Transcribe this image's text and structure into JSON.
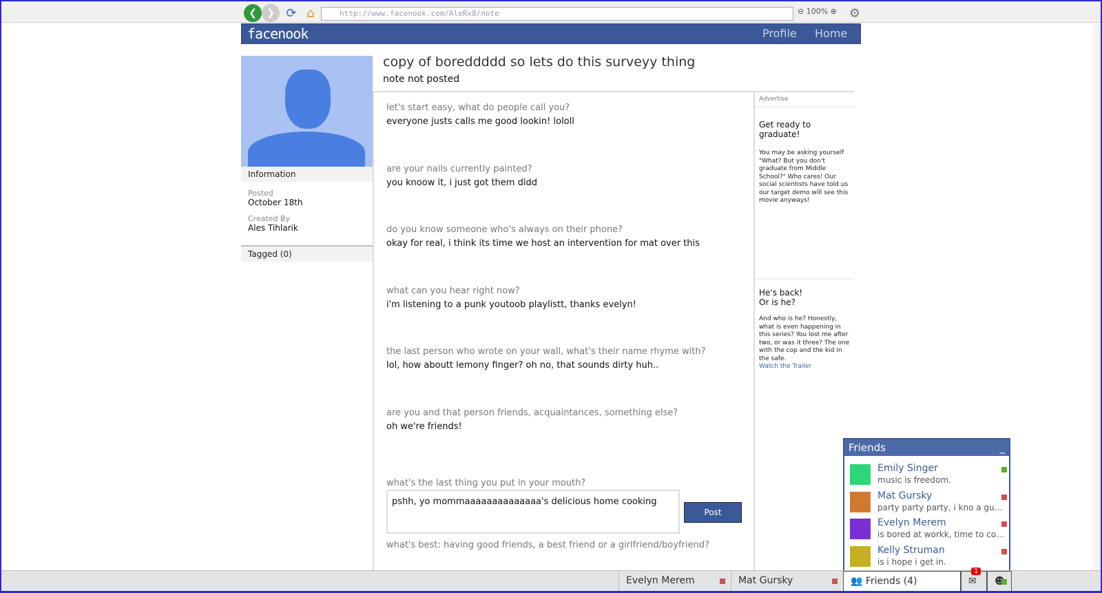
{
  "browser": {
    "url": "http://www.facenook.com/AleRx8/note",
    "zoom": "100%"
  },
  "header": {
    "logo": "facenook",
    "nav": [
      "Profile",
      "Home"
    ]
  },
  "note": {
    "title": "copy of boreddddd so lets do this surveyy thing",
    "status": "note not posted"
  },
  "sidebar": {
    "information": "Information",
    "posted_label": "Posted",
    "posted_value": "October 18th",
    "created_label": "Created By",
    "created_value": "Ales Tihlarik",
    "tagged": "Tagged (0)"
  },
  "survey": [
    {
      "q": "let's start easy, what do people call you?",
      "a": "everyone justs calls me good lookin! lololl"
    },
    {
      "q": "are your nails currently painted?",
      "a": "you knoow it, i just got them didd"
    },
    {
      "q": "do you know someone who's always on their phone?",
      "a": "okay for real, i think its time we host an intervention for mat over this"
    },
    {
      "q": "what can you hear right now?",
      "a": "i'm listening to a punk youtoob playlistt, thanks evelyn!"
    },
    {
      "q": "the last person who wrote on your wall, what's their name rhyme with?",
      "a": "lol, how aboutt lemony finger? oh no, that sounds dirty huh.."
    },
    {
      "q": "are you and that person friends, acquaintances, something else?",
      "a": "oh we're friends!"
    }
  ],
  "current": {
    "q": "what's the last thing you put in your mouth?",
    "answer": "pshh, yo mommaaaaaaaaaaaaaa's delicious home cooking",
    "post": "Post",
    "next_q": "what's best: having good friends, a best friend or a girlfriend/boyfriend?"
  },
  "ads": {
    "label": "Advertise",
    "ad1_title": "Get ready to graduate!",
    "ad1_body": "You may be asking yourself \"What? But you don't graduate from Middle School?\" Who cares! Our social scientists have told us our target demo will see this movie anyways!",
    "ad2_title1": "He's back!",
    "ad2_title2": "Or is he?",
    "ad2_body": "And who is he? Honestly, what is even happening in this series? You lost me after two, or was it three? The one with the cop and the kid in the safe.",
    "ad2_link": "Watch the Trailer"
  },
  "friends_panel": {
    "title": "Friends",
    "minimize": "_",
    "friends": [
      {
        "name": "Emily Singer",
        "status": "music is freedom.",
        "online": true,
        "color": "#2ed67a"
      },
      {
        "name": "Mat Gursky",
        "status": "party party party, i kno a guy n...",
        "online": false,
        "color": "#d07a30"
      },
      {
        "name": "Evelyn Merem",
        "status": "is bored at workk, time to cost...",
        "online": false,
        "color": "#7a2ed6"
      },
      {
        "name": "Kelly Struman",
        "status": "is i hope i get in.",
        "online": false,
        "color": "#c4b020"
      }
    ]
  },
  "bottombar": {
    "chats": [
      "Evelyn Merem",
      "Mat Gursky"
    ],
    "friends_tab": "Friends (4)",
    "notifications": "1"
  },
  "colors": {
    "brand": "#3b5998",
    "online": "#5cb030",
    "offline": "#d05050"
  }
}
